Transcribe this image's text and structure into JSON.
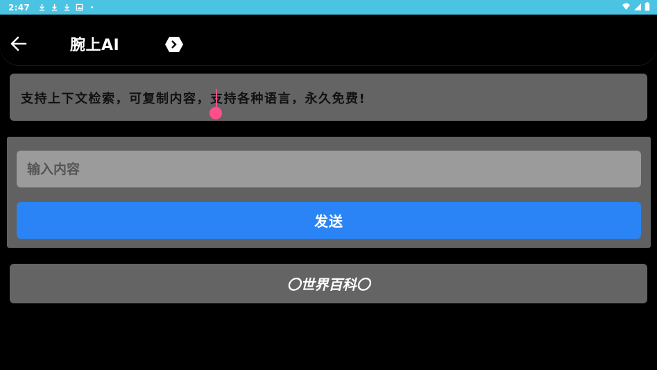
{
  "status_bar": {
    "time": "2:47",
    "icons": [
      "download-icon",
      "download-icon",
      "download-icon",
      "photo-icon",
      "dot-icon"
    ],
    "right_icons": [
      "wifi-icon",
      "signal-icon",
      "battery-icon"
    ],
    "background": "#4bc3e3"
  },
  "toolbar": {
    "title": "腕上AI",
    "back_icon": "arrow-left-icon",
    "menu_icon": "hexagon-chevron-icon"
  },
  "info": {
    "text": "支持上下文检索，可复制内容，支持各种语言，永久免费!"
  },
  "input": {
    "placeholder": "输入内容",
    "value": ""
  },
  "send": {
    "label": "发送",
    "color": "#2a84f5"
  },
  "wiki": {
    "label": "〇世界百科〇"
  },
  "colors": {
    "cursor": "#ff4f8b",
    "card": "#646464"
  }
}
